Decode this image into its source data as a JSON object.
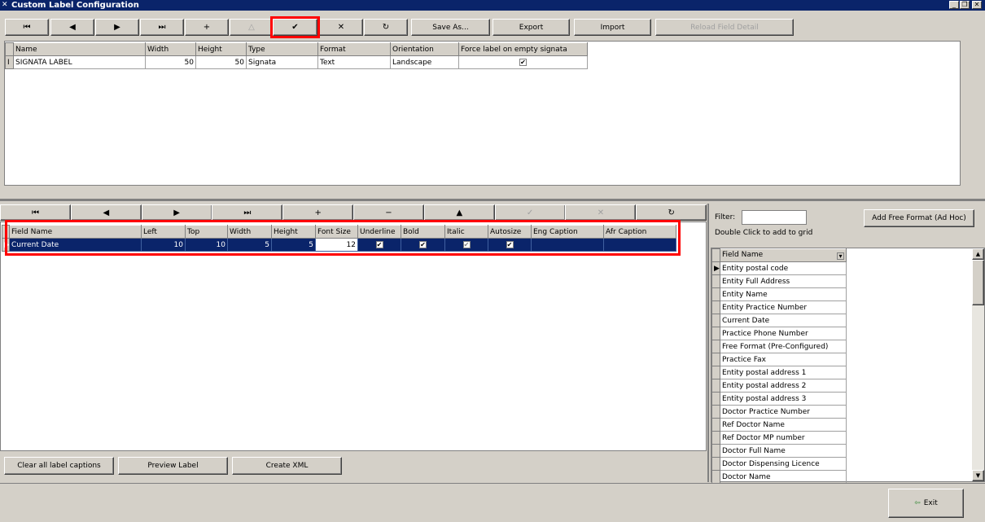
{
  "window": {
    "title": "Custom Label Configuration",
    "controls": [
      "_",
      "❐",
      "✕"
    ]
  },
  "top_toolbar": {
    "nav": [
      "⏮",
      "◀",
      "▶",
      "⏭",
      "+",
      "△",
      "✔",
      "✕",
      "↻"
    ],
    "save_as": "Save As...",
    "export": "Export",
    "import": "Import",
    "reload": "Reload Field Detail"
  },
  "label_grid": {
    "columns": [
      "Name",
      "Width",
      "Height",
      "Type",
      "Format",
      "Orientation",
      "Force label on empty signata"
    ],
    "rows": [
      {
        "indicator": "I",
        "name": "SIGNATA LABEL",
        "width": "50",
        "height": "50",
        "type": "Signata",
        "format": "Text",
        "orientation": "Landscape",
        "force": true
      }
    ]
  },
  "field_toolbar": {
    "nav": [
      "⏮",
      "◀",
      "▶",
      "⏭",
      "+",
      "−",
      "▲",
      "✓",
      "✕",
      "↻"
    ]
  },
  "field_grid": {
    "columns": [
      "Field Name",
      "Left",
      "Top",
      "Width",
      "Height",
      "Font Size",
      "Underline",
      "Bold",
      "Italic",
      "Autosize",
      "Eng Caption",
      "Afr Caption"
    ],
    "rows": [
      {
        "field_name": "Current Date",
        "left": "10",
        "top": "10",
        "width": "5",
        "height": "5",
        "font_size": "12",
        "underline": true,
        "bold": true,
        "italic": true,
        "autosize": true,
        "eng_caption": "",
        "afr_caption": ""
      }
    ]
  },
  "bottom_buttons": {
    "clear": "Clear all label captions",
    "preview": "Preview Label",
    "xml": "Create XML"
  },
  "right_panel": {
    "filter_label": "Filter:",
    "filter_value": "",
    "hint": "Double Click to add to grid",
    "add_free": "Add Free Format (Ad Hoc)",
    "list_header": "Field Name",
    "items": [
      "Entity postal code",
      "Entity Full Address",
      "Entity Name",
      "Entity Practice Number",
      "Current Date",
      "Practice Phone Number",
      "Free Format (Pre-Configured)",
      "Practice Fax",
      "Entity postal address 1",
      "Entity postal address 2",
      "Entity postal address 3",
      "Doctor Practice Number",
      "Ref Doctor Name",
      "Ref Doctor MP number",
      "Doctor Full Name",
      "Doctor Dispensing Licence",
      "Doctor Name"
    ]
  },
  "exit": "Exit"
}
